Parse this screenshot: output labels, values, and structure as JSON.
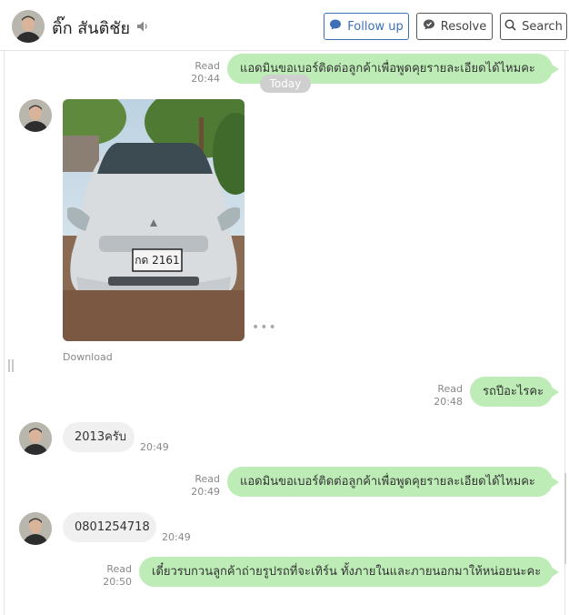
{
  "header": {
    "contact_name": "ติ๊ก สันติชัย",
    "follow_up_label": "Follow up",
    "resolve_label": "Resolve",
    "search_label": "Search"
  },
  "date_separator": "Today",
  "messages": [
    {
      "direction": "out",
      "text": "แอดมินขอเบอร์ติดต่อลูกค้าเพื่อพูดคุยรายละเอียดได้ไหมคะ",
      "status": "Read",
      "time": "20:44"
    },
    {
      "direction": "in",
      "type": "image",
      "image_plate": "กด 2161",
      "action": "Download"
    },
    {
      "direction": "out",
      "text": "รถปีอะไรคะ",
      "status": "Read",
      "time": "20:48"
    },
    {
      "direction": "in",
      "text": "2013ครับ",
      "time": "20:49"
    },
    {
      "direction": "out",
      "text": "แอดมินขอเบอร์ติดต่อลูกค้าเพื่อพูดคุยรายละเอียดได้ไหมคะ",
      "status": "Read",
      "time": "20:49"
    },
    {
      "direction": "in",
      "text": "0801254718",
      "time": "20:49"
    },
    {
      "direction": "out",
      "text": "เดี๋ยวรบกวนลูกค้าถ่ายรูปรถที่จะเทิร์น ทั้งภายในและภายนอกมาให้หน่อยนะคะ",
      "status": "Read",
      "time": "20:50"
    }
  ],
  "colors": {
    "outgoing_bubble": "#bdecb6",
    "incoming_bubble": "#f0f0f0",
    "follow_up_accent": "#3d6fb5"
  },
  "icons": [
    "speaker-icon",
    "follow-up-icon",
    "resolve-icon",
    "search-icon"
  ]
}
